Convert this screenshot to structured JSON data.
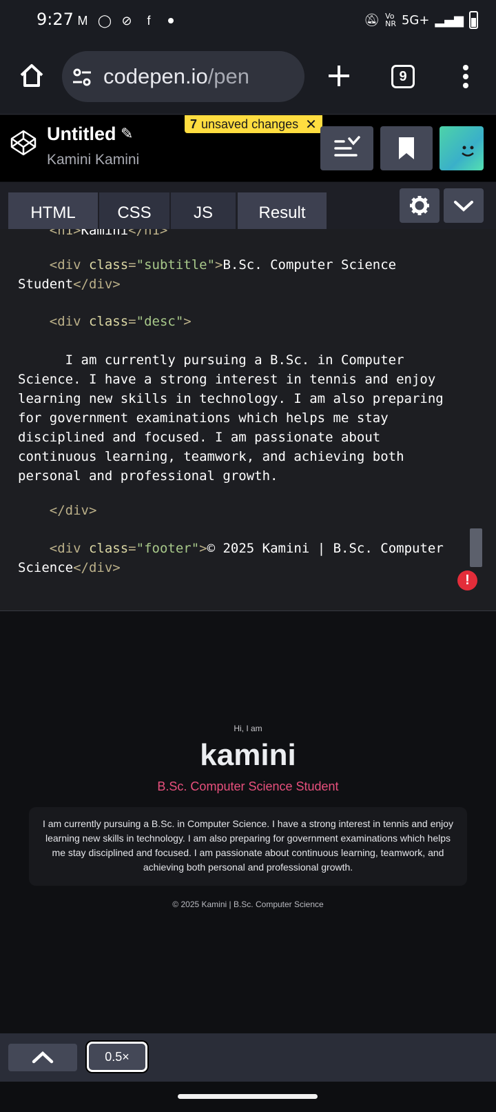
{
  "status_bar": {
    "time": "9:27",
    "network": "5G+"
  },
  "browser": {
    "url_host": "codepen.io",
    "url_path": "/pen",
    "tab_count": "9"
  },
  "pen": {
    "title": "Untitled",
    "author": "Kamini Kamini",
    "unsaved_count": "7",
    "unsaved_label": "unsaved changes"
  },
  "tabs": [
    {
      "label": "HTML"
    },
    {
      "label": "CSS"
    },
    {
      "label": "JS"
    },
    {
      "label": "Result"
    }
  ],
  "code": {
    "partial_top": "Kamini",
    "subtitle_class": "\"subtitle\"",
    "subtitle_text1": "B.Sc. Computer Science",
    "subtitle_text2": "Student",
    "desc_class": "\"desc\"",
    "desc_lines": [
      "      I am currently pursuing a B.Sc. in Computer",
      "Science. I have a strong interest in tennis and enjoy",
      "learning new skills in technology. I am also preparing",
      "for government examinations which helps me stay",
      "disciplined and focused. I am passionate about",
      "continuous learning, teamwork, and achieving both",
      "personal and professional growth."
    ],
    "footer_class": "\"footer\"",
    "footer_text1": "© 2025 Kamini | B.Sc. Computer",
    "footer_text2": "Science"
  },
  "result": {
    "greeting": "Hi, I am",
    "name": "kamini",
    "subtitle": "B.Sc. Computer Science Student",
    "description": "I am currently pursuing a B.Sc. in Computer Science. I have a strong interest in tennis and enjoy learning new skills in technology. I am also preparing for government examinations which helps me stay disciplined and focused. I am passionate about continuous learning, teamwork, and achieving both personal and professional growth.",
    "footer": "© 2025 Kamini | B.Sc. Computer Science"
  },
  "bottom": {
    "zoom": "0.5×"
  },
  "colors": {
    "accent_pink": "#e8507d",
    "unsaved_yellow": "#ffdd40",
    "error_red": "#e32d3a"
  },
  "icons": [
    "gmail-icon",
    "whatsapp-icon",
    "shazam-icon",
    "facebook-icon",
    "mute-icon",
    "vonr-icon",
    "signal-icon",
    "battery-icon",
    "home-icon",
    "tune-icon",
    "plus-icon",
    "tabs-icon",
    "more-vert-icon",
    "codepen-logo-icon",
    "pencil-icon",
    "close-icon",
    "changes-icon",
    "bookmark-icon",
    "gear-icon",
    "chevron-down-icon",
    "chevron-up-icon",
    "error-icon"
  ]
}
